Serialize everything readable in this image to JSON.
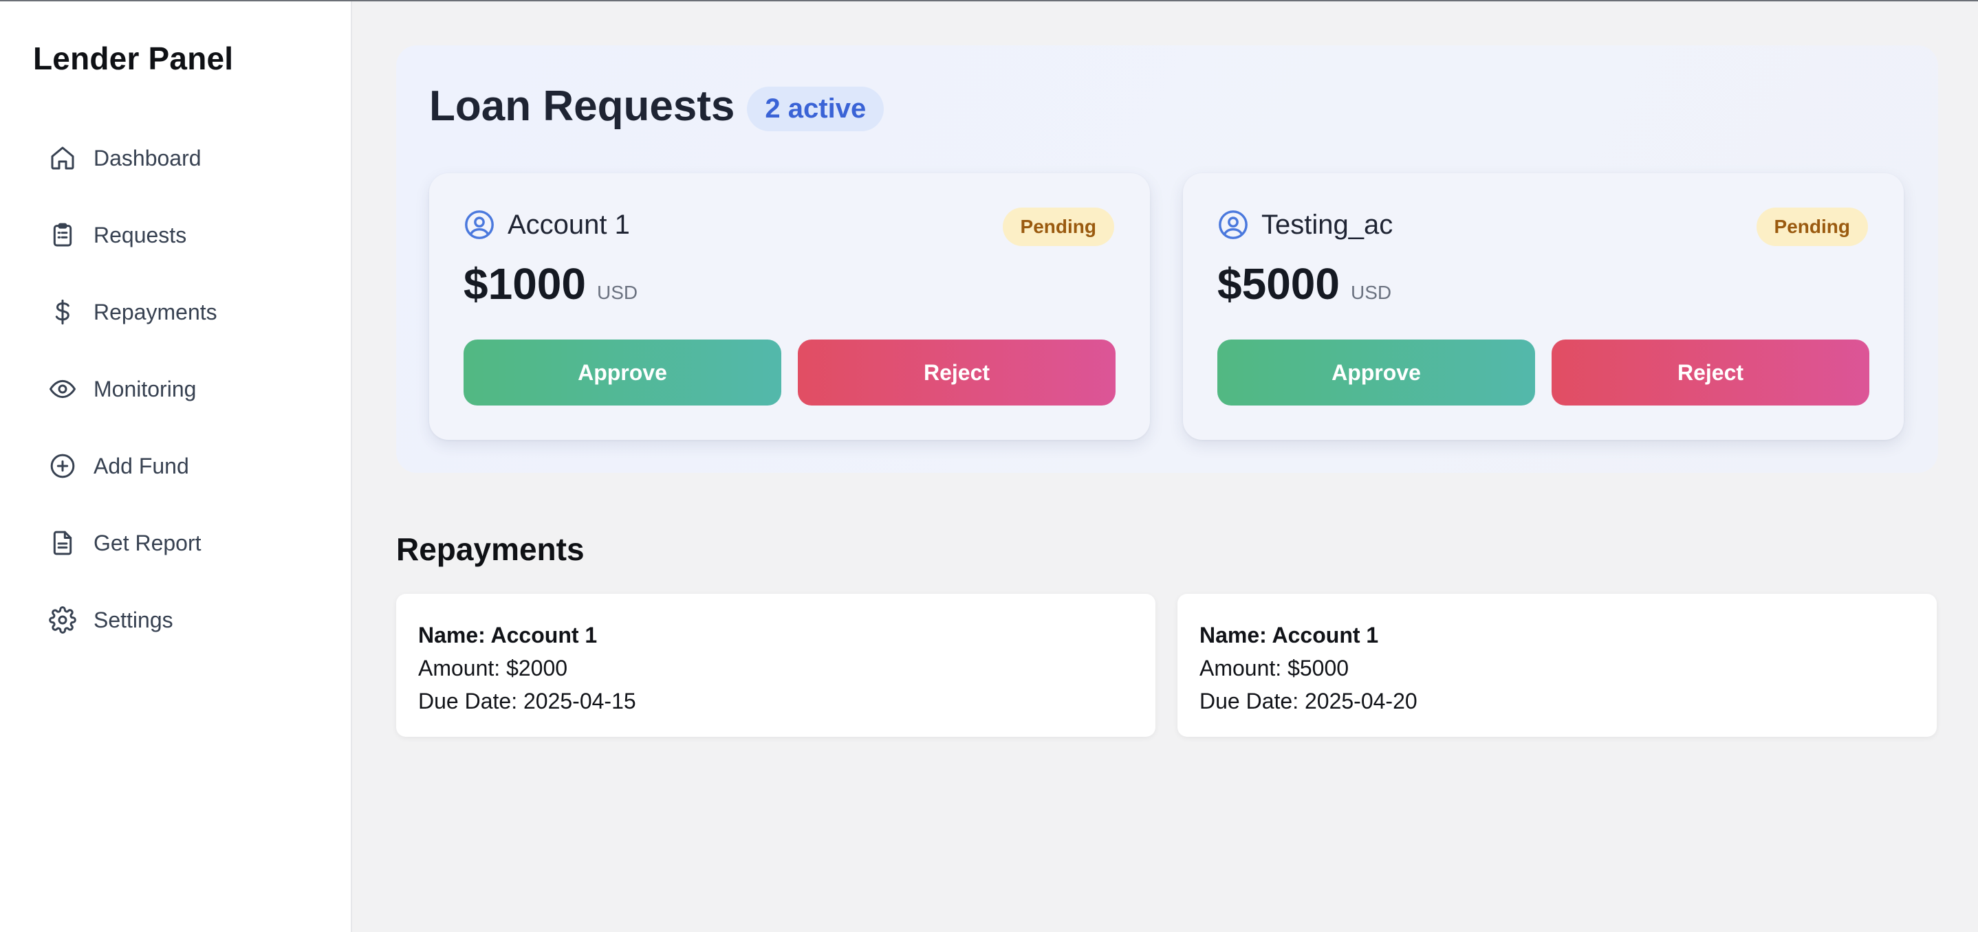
{
  "sidebar": {
    "brand": "Lender Panel",
    "items": [
      {
        "label": "Dashboard",
        "icon": "home-icon"
      },
      {
        "label": "Requests",
        "icon": "clipboard-icon"
      },
      {
        "label": "Repayments",
        "icon": "dollar-icon"
      },
      {
        "label": "Monitoring",
        "icon": "eye-icon"
      },
      {
        "label": "Add Fund",
        "icon": "plus-circle-icon"
      },
      {
        "label": "Get Report",
        "icon": "document-icon"
      },
      {
        "label": "Settings",
        "icon": "gear-icon"
      }
    ]
  },
  "requests": {
    "title": "Loan Requests",
    "active_badge": "2 active",
    "cards": [
      {
        "name": "Account 1",
        "status": "Pending",
        "amount": "$1000",
        "currency": "USD",
        "approve_label": "Approve",
        "reject_label": "Reject"
      },
      {
        "name": "Testing_ac",
        "status": "Pending",
        "amount": "$5000",
        "currency": "USD",
        "approve_label": "Approve",
        "reject_label": "Reject"
      }
    ]
  },
  "repayments": {
    "title": "Repayments",
    "items": [
      {
        "name": "Name: Account 1",
        "amount": "Amount: $2000",
        "due": "Due Date: 2025-04-15"
      },
      {
        "name": "Name: Account 1",
        "amount": "Amount: $5000",
        "due": "Due Date: 2025-04-20"
      }
    ]
  },
  "colors": {
    "accent_blue": "#3a63d6",
    "approve_green": "#52b882",
    "reject_red": "#e14e63",
    "pending_bg": "#fcefc6",
    "pending_text": "#9a5a0f"
  }
}
